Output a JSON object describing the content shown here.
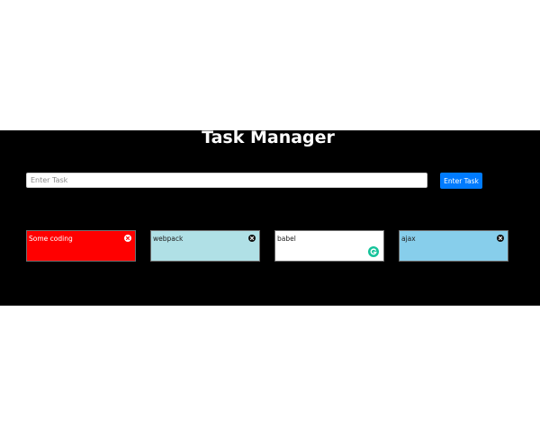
{
  "header": {
    "title": "Task Manager"
  },
  "form": {
    "input_value": "",
    "input_placeholder": "Enter Task",
    "submit_label": "Enter Task"
  },
  "tasks": [
    {
      "label": "Some coding",
      "color": "#ff0000",
      "text_color": "#ffffff",
      "icon": "close-icon"
    },
    {
      "label": "webpack",
      "color": "#b0e0e6",
      "text_color": "#222222",
      "icon": "close-icon"
    },
    {
      "label": "babel",
      "color": "#ffffff",
      "text_color": "#222222",
      "icon": "grammarly-icon"
    },
    {
      "label": "ajax",
      "color": "#87ceeb",
      "text_color": "#222222",
      "icon": "close-icon"
    }
  ],
  "colors": {
    "background": "#000000",
    "accent": "#007bff"
  }
}
